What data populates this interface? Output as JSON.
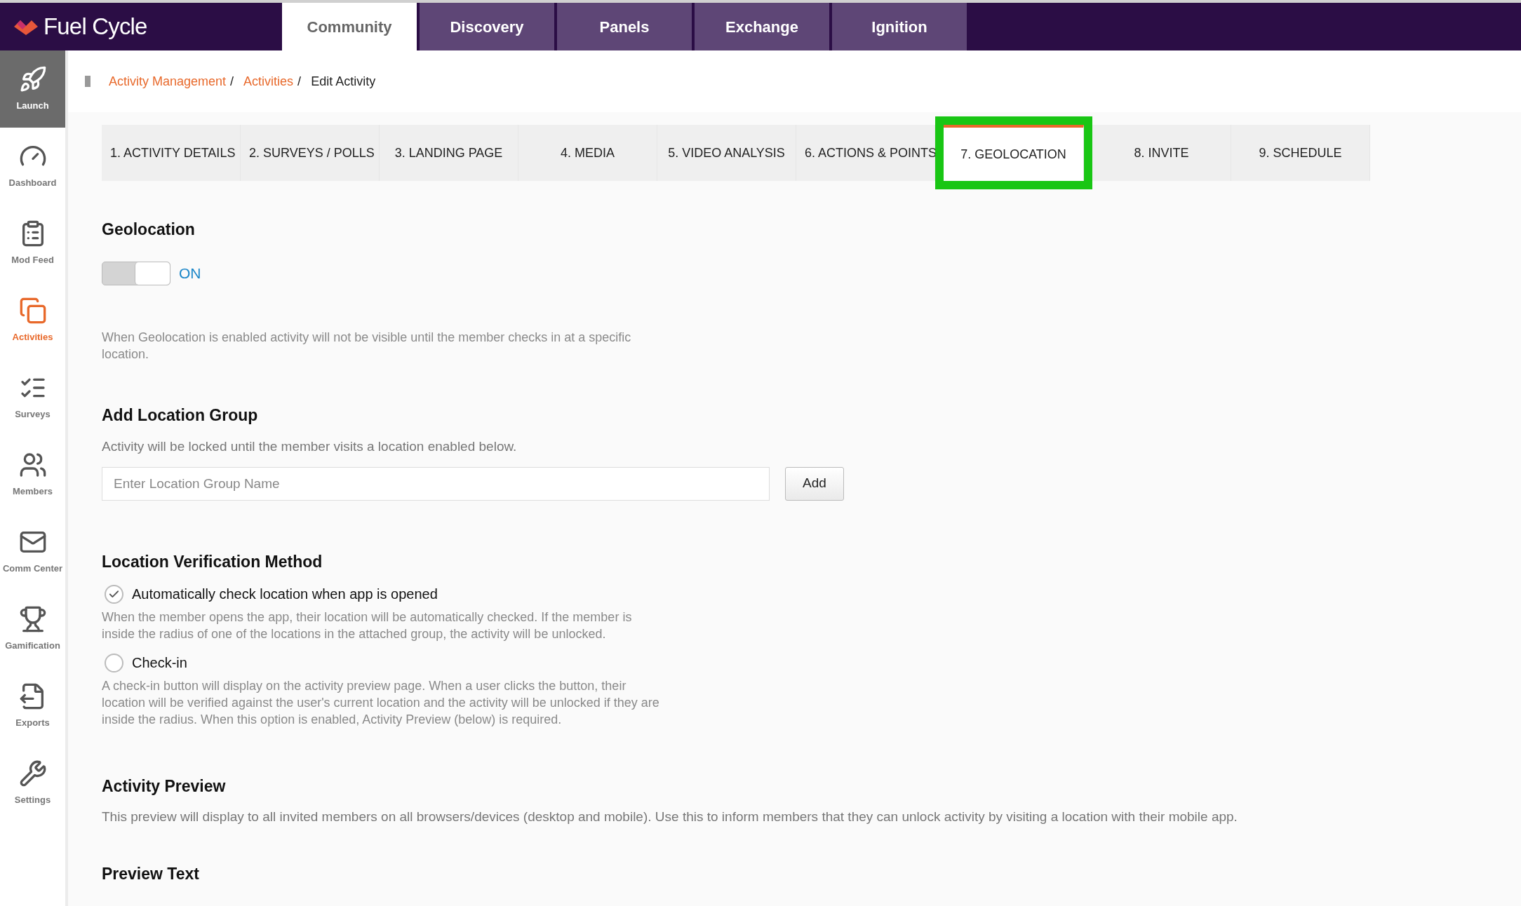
{
  "brand": {
    "name": "Fuel Cycle"
  },
  "top_tabs": [
    {
      "label": "Community",
      "selected": true
    },
    {
      "label": "Discovery",
      "selected": false
    },
    {
      "label": "Panels",
      "selected": false
    },
    {
      "label": "Exchange",
      "selected": false
    },
    {
      "label": "Ignition",
      "selected": false
    }
  ],
  "sidebar": {
    "items": [
      {
        "label": "Launch",
        "kind": "launch",
        "selected": false
      },
      {
        "label": "Dashboard",
        "kind": "gauge",
        "selected": false
      },
      {
        "label": "Mod Feed",
        "kind": "clipboard",
        "selected": false
      },
      {
        "label": "Activities",
        "kind": "copy",
        "selected": true
      },
      {
        "label": "Surveys",
        "kind": "list",
        "selected": false
      },
      {
        "label": "Members",
        "kind": "users",
        "selected": false
      },
      {
        "label": "Comm Center",
        "kind": "mail",
        "selected": false
      },
      {
        "label": "Gamification",
        "kind": "trophy",
        "selected": false
      },
      {
        "label": "Exports",
        "kind": "export",
        "selected": false
      },
      {
        "label": "Settings",
        "kind": "tools",
        "selected": false
      }
    ]
  },
  "breadcrumb": [
    {
      "label": "Activity Management",
      "link": true
    },
    {
      "separator": "/",
      "label": "Activities",
      "link": true
    },
    {
      "separator": "/",
      "label": "Edit Activity",
      "link": false
    }
  ],
  "step_tabs": [
    {
      "label": "1. ACTIVITY DETAILS",
      "selected": false,
      "highlighted": false
    },
    {
      "label": "2. SURVEYS / POLLS",
      "selected": false,
      "highlighted": false
    },
    {
      "label": "3. LANDING PAGE",
      "selected": false,
      "highlighted": false
    },
    {
      "label": "4. MEDIA",
      "selected": false,
      "highlighted": false
    },
    {
      "label": "5. VIDEO ANALYSIS",
      "selected": false,
      "highlighted": false
    },
    {
      "label": "6. ACTIONS & POINTS",
      "selected": false,
      "highlighted": false
    },
    {
      "label": "7. GEOLOCATION",
      "selected": true,
      "highlighted": true
    },
    {
      "label": "8. INVITE",
      "selected": false,
      "highlighted": false
    },
    {
      "label": "9. SCHEDULE",
      "selected": false,
      "highlighted": false
    }
  ],
  "geolocation": {
    "heading": "Geolocation",
    "toggle": {
      "on": true,
      "label": "ON"
    },
    "note": "When Geolocation is enabled activity will not be visible until the member checks in at a specific location."
  },
  "location_group": {
    "heading": "Add Location Group",
    "description": "Activity will be locked until the member visits a location enabled below.",
    "placeholder": "Enter Location Group Name",
    "button": "Add"
  },
  "verification": {
    "heading": "Location Verification Method",
    "options": [
      {
        "label": "Automatically check location when app is opened",
        "selected": true,
        "description": "When the member opens the app, their location will be automatically checked. If the member is inside the radius of one of the locations in the attached group, the activity will be unlocked."
      },
      {
        "label": "Check-in",
        "selected": false,
        "description": "A check-in button will display on the activity preview page. When a user clicks the button, their location will be verified against the user's current location and the activity will be unlocked if they are inside the radius. When this option is enabled, Activity Preview (below) is required."
      }
    ]
  },
  "activity_preview": {
    "heading": "Activity Preview",
    "description": "This preview will display to all invited members on all browsers/devices (desktop and mobile). Use this to inform members that they can unlock activity by visiting a location with their mobile app."
  },
  "preview_text": {
    "heading": "Preview Text"
  }
}
